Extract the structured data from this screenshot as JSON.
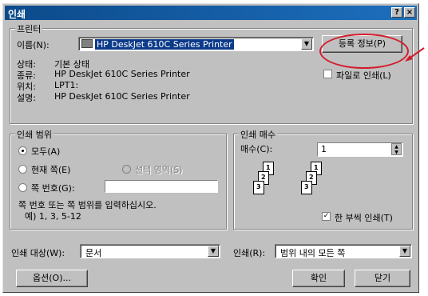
{
  "window": {
    "title": "인쇄",
    "help_button": "?",
    "close_button": "×"
  },
  "printer": {
    "group_label": "프린터",
    "name_label": "이름(N):",
    "name_value": "HP DeskJet 610C Series Printer",
    "properties_button": "등록 정보(P)",
    "status_label": "상태:",
    "status_value": "기본 상태",
    "type_label": "종류:",
    "type_value": "HP DeskJet 610C Series Printer",
    "where_label": "위치:",
    "where_value": "LPT1:",
    "comment_label": "설명:",
    "comment_value": "HP DeskJet 610C Series Printer",
    "print_to_file": "파일로 인쇄(L)",
    "print_to_file_checked": false
  },
  "range": {
    "group_label": "인쇄 범위",
    "all": "모두(A)",
    "current_page": "현재 쪽(E)",
    "selection": "선택 영역(S)",
    "pages": "쪽 번호(G):",
    "pages_value": "",
    "hint_line1": "쪽 번호 또는 쪽 범위를 입력하십시오.",
    "hint_line2": "예) 1, 3, 5-12",
    "selected": "all"
  },
  "copies": {
    "group_label": "인쇄 매수",
    "count_label": "매수(C):",
    "count_value": "1",
    "page_icons": [
      "1",
      "2",
      "3",
      "1",
      "2",
      "3"
    ],
    "collate": "한 부씩 인쇄(T)",
    "collate_checked": true
  },
  "bottom": {
    "print_what_label": "인쇄 대상(W):",
    "print_what_value": "문서",
    "print_label": "인쇄(R):",
    "print_value": "범위 내의 모든 쪽",
    "options_button": "옵션(O)...",
    "ok_button": "확인",
    "close_button": "닫기"
  },
  "annotation": {
    "color": "#d21d2d",
    "arrow_icon": "red-arrow-icon"
  }
}
